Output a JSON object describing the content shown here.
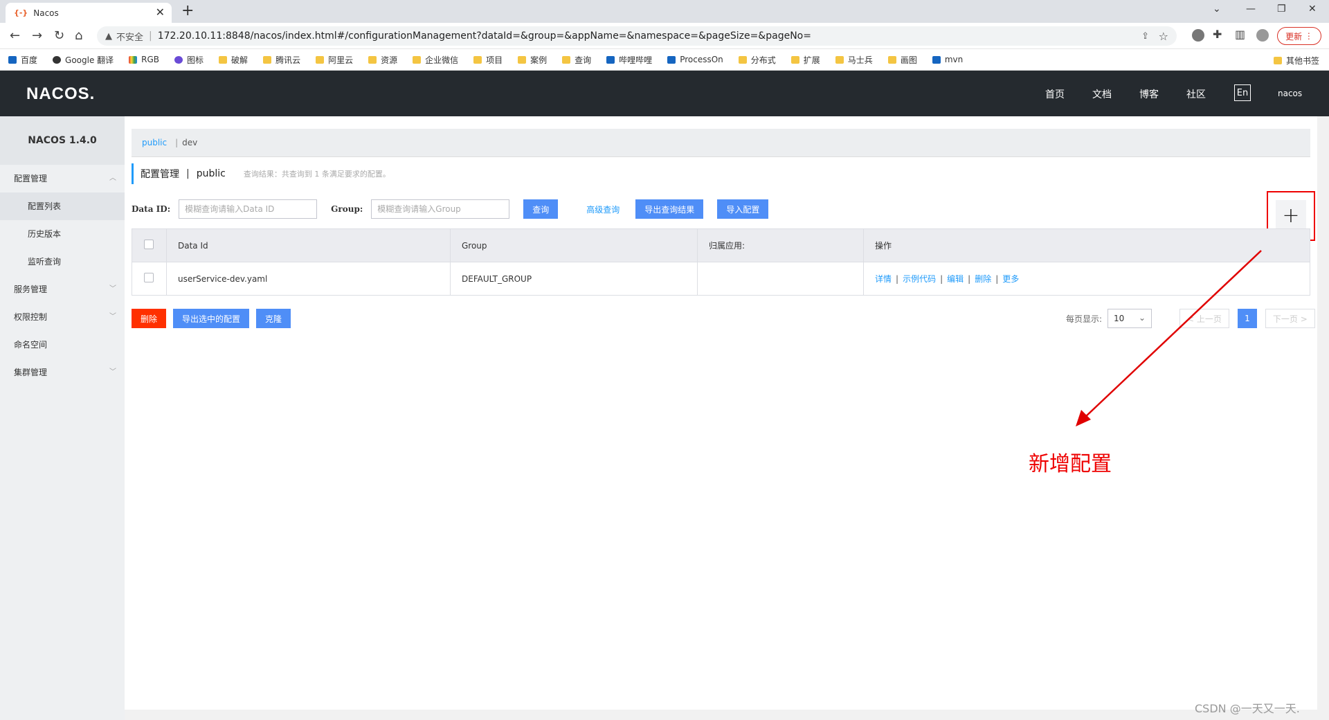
{
  "browser": {
    "tab_title": "Nacos",
    "tab_favicon": "{-}",
    "security_label": "不安全",
    "url": "172.20.10.11:8848/nacos/index.html#/configurationManagement?dataId=&group=&appName=&namespace=&pageSize=&pageNo=",
    "update_label": "更新",
    "bookmarks": [
      "百度",
      "Google 翻译",
      "RGB",
      "图标",
      "破解",
      "腾讯云",
      "阿里云",
      "资源",
      "企业微信",
      "项目",
      "案例",
      "查询",
      "哔哩哔哩",
      "ProcessOn",
      "分布式",
      "扩展",
      "马士兵",
      "画图",
      "mvn"
    ],
    "other_bookmarks": "其他书签"
  },
  "header": {
    "logo": "NACOS.",
    "nav": [
      "首页",
      "文档",
      "博客",
      "社区"
    ],
    "lang": "En",
    "user": "nacos"
  },
  "sidebar": {
    "version": "NACOS 1.4.0",
    "items": [
      {
        "label": "配置管理",
        "type": "group"
      },
      {
        "label": "配置列表",
        "type": "sub"
      },
      {
        "label": "历史版本",
        "type": "sub"
      },
      {
        "label": "监听查询",
        "type": "sub"
      },
      {
        "label": "服务管理",
        "type": "group"
      },
      {
        "label": "权限控制",
        "type": "group"
      },
      {
        "label": "命名空间",
        "type": "plain"
      },
      {
        "label": "集群管理",
        "type": "group"
      }
    ]
  },
  "namespaces": {
    "active": "public",
    "other": "dev"
  },
  "page": {
    "title": "配置管理",
    "namespace": "public",
    "description": "查询结果：共查询到 1 条满足要求的配置。"
  },
  "query": {
    "dataid_label": "Data ID:",
    "dataid_placeholder": "模糊查询请输入Data ID",
    "group_label": "Group:",
    "group_placeholder": "模糊查询请输入Group",
    "search_btn": "查询",
    "advanced_btn": "高级查询",
    "export_btn": "导出查询结果",
    "import_btn": "导入配置",
    "add_btn": "+"
  },
  "table": {
    "headers": [
      "Data Id",
      "Group",
      "归属应用:",
      "操作"
    ],
    "rows": [
      {
        "data_id": "userService-dev.yaml",
        "group": "DEFAULT_GROUP",
        "app": ""
      }
    ],
    "actions": [
      "详情",
      "示例代码",
      "编辑",
      "删除",
      "更多"
    ]
  },
  "bottom": {
    "delete_btn": "删除",
    "export_selected_btn": "导出选中的配置",
    "clone_btn": "克隆"
  },
  "pagination": {
    "per_page_label": "每页显示:",
    "page_size": "10",
    "prev": "< 上一页",
    "current": "1",
    "next": "下一页 >"
  },
  "annotation": {
    "text": "新增配置",
    "color": "#e00000"
  },
  "watermark": "CSDN @一天又一天."
}
